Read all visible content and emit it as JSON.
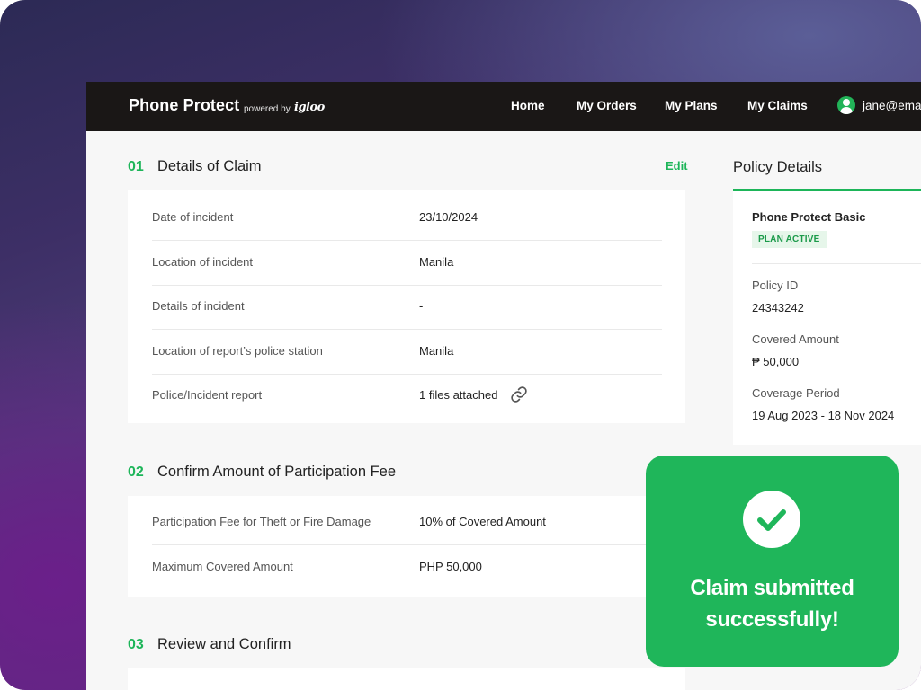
{
  "header": {
    "brand": "Phone Protect",
    "powered_by": "powered by",
    "partner_logo": "igloo",
    "nav": [
      "Home",
      "My Orders",
      "My Plans",
      "My Claims"
    ],
    "user_email": "jane@ema",
    "user_icon": "user-avatar-icon"
  },
  "sections": [
    {
      "number": "01",
      "title": "Details of Claim",
      "action": "Edit",
      "rows": [
        {
          "label": "Date of incident",
          "value": "23/10/2024"
        },
        {
          "label": "Location of incident",
          "value": "Manila"
        },
        {
          "label": "Details of incident",
          "value": "-"
        },
        {
          "label": "Location of report’s police station",
          "value": "Manila"
        },
        {
          "label": "Police/Incident report",
          "value": "1 files attached",
          "icon": "link-icon"
        }
      ]
    },
    {
      "number": "02",
      "title": "Confirm Amount of Participation Fee",
      "rows": [
        {
          "label": "Participation Fee for Theft or Fire Damage",
          "value": "10% of Covered Amount"
        },
        {
          "label": "Maximum Covered Amount",
          "value": "PHP 50,000"
        }
      ]
    },
    {
      "number": "03",
      "title": "Review and Confirm"
    }
  ],
  "policy": {
    "title": "Policy Details",
    "plan_name": "Phone Protect Basic",
    "status": "PLAN ACTIVE",
    "fields": [
      {
        "label": "Policy ID",
        "value": "24343242"
      },
      {
        "label": "Covered Amount",
        "value": "₱ 50,000"
      },
      {
        "label": "Coverage Period",
        "value": "19 Aug 2023 - 18 Nov 2024"
      }
    ]
  },
  "toast": {
    "icon": "check-circle-icon",
    "line1": "Claim submitted",
    "line2": "successfully!"
  },
  "colors": {
    "accent": "#1db559",
    "topbar": "#1a1716",
    "toast": "#1fb65a"
  }
}
